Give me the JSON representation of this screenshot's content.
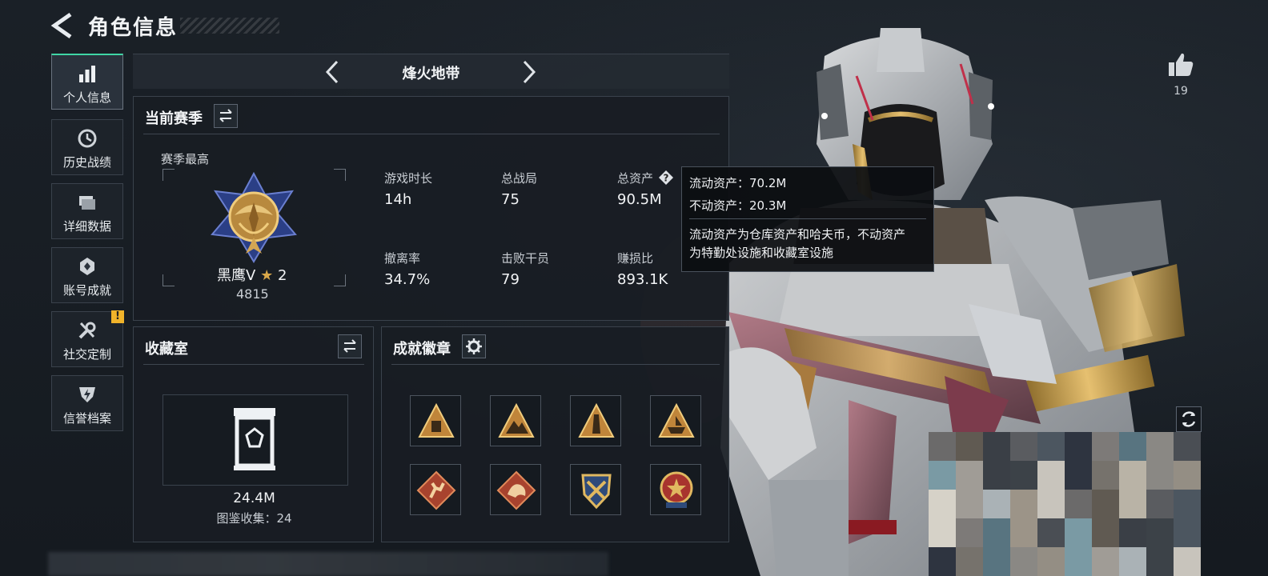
{
  "header": {
    "title": "角色信息"
  },
  "sidebar": {
    "items": [
      {
        "label": "个人信息",
        "icon": "bar-chart-icon",
        "active": true
      },
      {
        "label": "历史战绩",
        "icon": "clock-icon"
      },
      {
        "label": "详细数据",
        "icon": "folder-icon"
      },
      {
        "label": "账号成就",
        "icon": "achievement-icon"
      },
      {
        "label": "社交定制",
        "icon": "wrench-icon",
        "badge": "!"
      },
      {
        "label": "信誉档案",
        "icon": "shield-lightning-icon"
      }
    ]
  },
  "mode_bar": {
    "title": "烽火地带"
  },
  "season": {
    "title": "当前赛季",
    "best_label": "赛季最高",
    "rank_name": "黑鹰V",
    "rank_stars": "2",
    "rank_points": "4815",
    "stats": [
      {
        "label": "游戏时长",
        "value": "14h"
      },
      {
        "label": "总战局",
        "value": "75"
      },
      {
        "label": "总资产",
        "value": "90.5M"
      },
      {
        "label": "撤离率",
        "value": "34.7%"
      },
      {
        "label": "击败干员",
        "value": "79"
      },
      {
        "label": "赚损比",
        "value": "893.1K"
      }
    ]
  },
  "tooltip": {
    "line1": "流动资产：70.2M",
    "line2": "不动资产：20.3M",
    "desc1": "流动资产为仓库资产和哈夫币，不动资产",
    "desc2": "为特勤处设施和收藏室设施"
  },
  "collection": {
    "title": "收藏室",
    "value": "24.4M",
    "caption": "图鉴收集：24"
  },
  "badges": {
    "title": "成就徽章",
    "items": [
      "triangle-emblem",
      "triangle-mountain",
      "triangle-tower",
      "triangle-ship",
      "diamond-runner",
      "diamond-dragon",
      "shield-crossed",
      "star-emblem"
    ]
  },
  "likes": {
    "count": "19"
  },
  "colors": {
    "accent": "#3fd6a5",
    "gold": "#d9a84a",
    "warning": "#f0b32a"
  }
}
